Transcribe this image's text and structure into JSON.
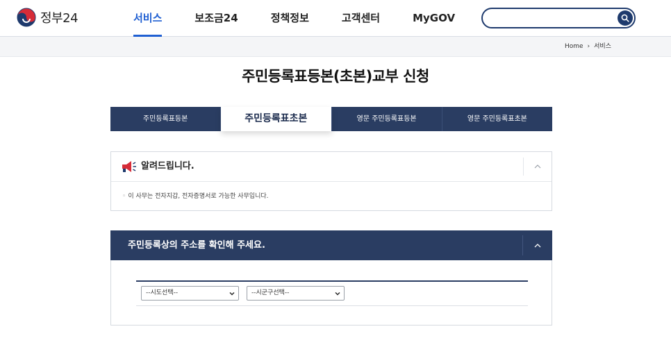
{
  "brand": {
    "name": "정부24"
  },
  "nav": {
    "items": [
      "서비스",
      "보조금24",
      "정책정보",
      "고객센터",
      "MyGOV"
    ],
    "active_index": 0
  },
  "search": {
    "placeholder": "",
    "value": ""
  },
  "breadcrumb": {
    "home": "Home",
    "separator": "›",
    "current": "서비스"
  },
  "page": {
    "title": "주민등록표등본(초본)교부 신청"
  },
  "tabs": [
    {
      "label": "주민등록표등본",
      "active": false
    },
    {
      "label": "주민등록표초본",
      "active": true
    },
    {
      "label": "영문 주민등록표등본",
      "active": false
    },
    {
      "label": "영문 주민등록표초본",
      "active": false
    }
  ],
  "notice": {
    "title": "알려드립니다.",
    "icon": "megaphone-icon",
    "items": [
      "이 사무는 전자지갑, 전자증명서로 가능한 사무입니다."
    ]
  },
  "address": {
    "title": "주민등록상의 주소를 확인해 주세요.",
    "sido_select": "--시도선택--",
    "sigungu_select": "--시군구선택--"
  },
  "colors": {
    "navy": "#2a3d62",
    "accent_blue": "#1f5fd2",
    "search_border": "#1e3a6d"
  }
}
